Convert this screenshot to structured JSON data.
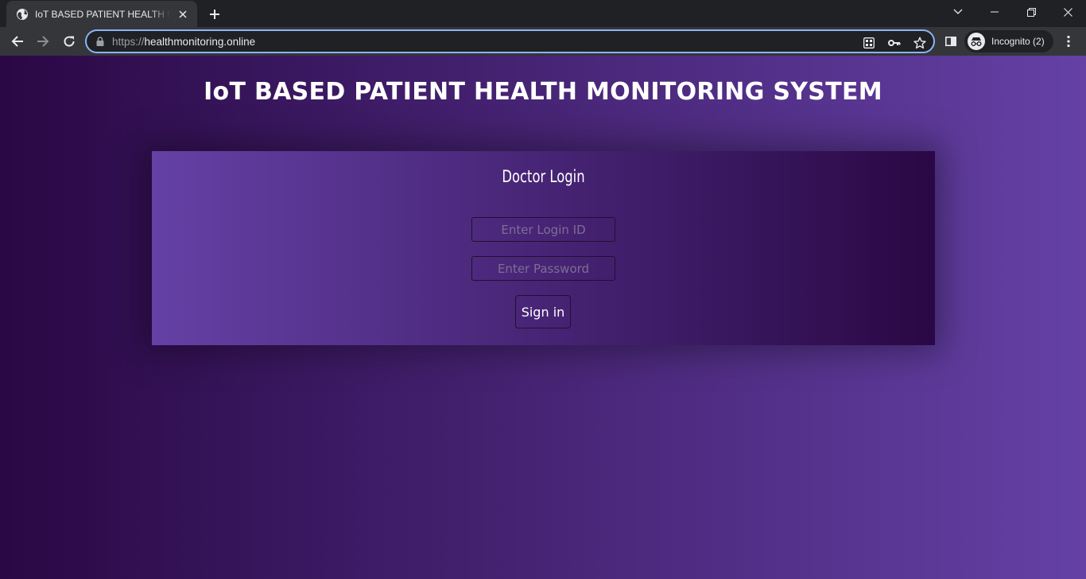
{
  "browser": {
    "tab_title": "IoT BASED PATIENT HEALTH MONITORING SYSTEM",
    "url_scheme": "https://",
    "url_host": "healthmonitoring.online",
    "profile_label": "Incognito (2)"
  },
  "page": {
    "title": "IoT BASED PATIENT HEALTH MONITORING SYSTEM",
    "login_heading": "Doctor Login",
    "login_id_placeholder": "Enter Login ID",
    "password_placeholder": "Enter Password",
    "signin_label": "Sign in"
  },
  "colors": {
    "gradient_dark": "#2a0845",
    "gradient_light": "#6441a5",
    "omnibox_focus": "#8ab4f8",
    "chrome_dark": "#202124",
    "chrome_mid": "#35363a"
  }
}
